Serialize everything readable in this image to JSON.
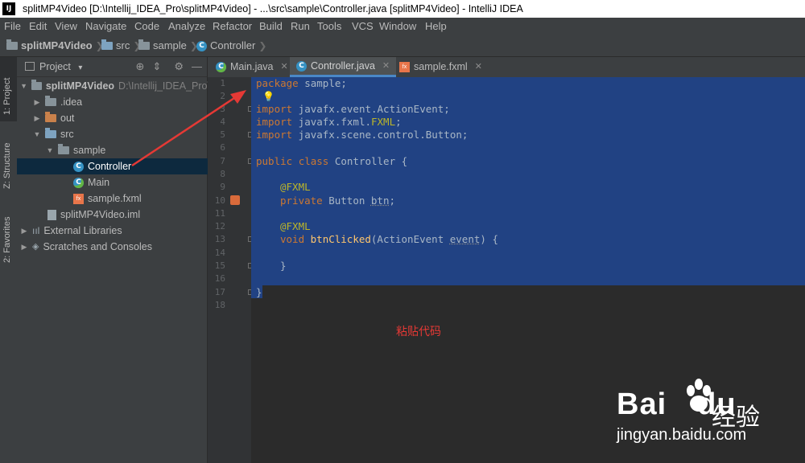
{
  "window": {
    "title": "splitMP4Video [D:\\Intellij_IDEA_Pro\\splitMP4Video] - ...\\src\\sample\\Controller.java [splitMP4Video] - IntelliJ IDEA",
    "app_icon": "IJ"
  },
  "menu": [
    "File",
    "Edit",
    "View",
    "Navigate",
    "Code",
    "Analyze",
    "Refactor",
    "Build",
    "Run",
    "Tools",
    "VCS",
    "Window",
    "Help"
  ],
  "breadcrumb": [
    "splitMP4Video",
    "src",
    "sample",
    "Controller"
  ],
  "side_tabs": [
    "1: Project",
    "Z: Structure",
    "2: Favorites"
  ],
  "project_panel": {
    "title": "Project",
    "dropdown": "▾",
    "tree": [
      {
        "label": "splitMP4Video",
        "extra": "D:\\Intellij_IDEA_Pro\\",
        "icon": "module-folder-icon"
      },
      {
        "label": ".idea",
        "icon": "folder-icon"
      },
      {
        "label": "out",
        "icon": "folder-orange-icon"
      },
      {
        "label": "src",
        "icon": "folder-blue-icon"
      },
      {
        "label": "sample",
        "icon": "package-icon"
      },
      {
        "label": "Controller",
        "icon": "class-icon"
      },
      {
        "label": "Main",
        "icon": "class-run-icon"
      },
      {
        "label": "sample.fxml",
        "icon": "fxml-icon"
      },
      {
        "label": "splitMP4Video.iml",
        "icon": "iml-icon"
      },
      {
        "label": "External Libraries",
        "icon": "libraries-icon"
      },
      {
        "label": "Scratches and Consoles",
        "icon": "scratches-icon"
      }
    ]
  },
  "editor_tabs": [
    {
      "label": "Main.java",
      "icon": "class-run-icon"
    },
    {
      "label": "Controller.java",
      "icon": "class-icon",
      "active": true
    },
    {
      "label": "sample.fxml",
      "icon": "fxml-icon"
    }
  ],
  "line_numbers": [
    "1",
    "2",
    "3",
    "4",
    "5",
    "6",
    "7",
    "8",
    "9",
    "10",
    "11",
    "12",
    "13",
    "14",
    "15",
    "16",
    "17",
    "18"
  ],
  "code": {
    "l1_kw": "package",
    "l1_rest": " sample;",
    "l3_kw": "import",
    "l3_rest": " javafx.event.ActionEvent;",
    "l4_kw": "import",
    "l4_rest": " javafx.fxml.",
    "l4_ann": "FXML",
    "l4_end": ";",
    "l5_kw": "import",
    "l5_rest": " javafx.scene.control.Button;",
    "l7_kw1": "public",
    "l7_kw2": "class",
    "l7_rest": " Controller {",
    "l9_ann": "@FXML",
    "l10_kw": "private",
    "l10_type": " Button ",
    "l10_var": "btn",
    "l10_end": ";",
    "l12_ann": "@FXML",
    "l13_kw": "void",
    "l13_fn": "btnClicked",
    "l13_params_a": "(ActionEvent ",
    "l13_param": "event",
    "l13_end": ") {",
    "l15_text": "}",
    "l17_text": "}"
  },
  "annotation": "粘贴代码",
  "watermark": {
    "brand_a": "Bai",
    "brand_b": "du",
    "brand_zh": "经验",
    "url": "jingyan.baidu.com"
  },
  "colors": {
    "selection": "#214283",
    "keyword": "#cc7832",
    "annotation": "#bbb529",
    "arrow": "#e53935"
  }
}
